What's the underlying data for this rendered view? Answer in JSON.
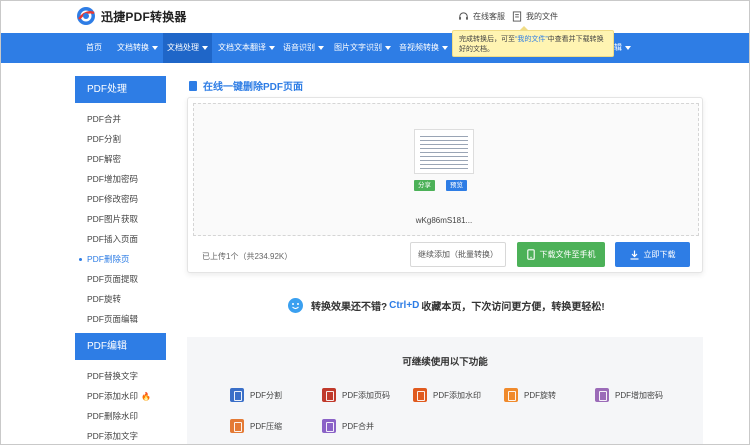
{
  "header": {
    "app_name": "迅捷PDF转换器",
    "support_label": "在线客服",
    "my_files_label": "我的文件"
  },
  "nav": {
    "items": [
      {
        "label": "首页",
        "has_caret": false
      },
      {
        "label": "文档转换",
        "has_caret": true
      },
      {
        "label": "文档处理",
        "has_caret": true,
        "active": true
      },
      {
        "label": "文档文本翻译",
        "has_caret": true
      },
      {
        "label": "语音识别",
        "has_caret": true
      },
      {
        "label": "图片文字识别",
        "has_caret": true
      },
      {
        "label": "音视频转换",
        "has_caret": true
      },
      {
        "label": "辑",
        "has_caret": true
      }
    ]
  },
  "tooltip": {
    "prefix": "完成转换后，可至",
    "link": "“我的文件”",
    "suffix": "中查看并下载转换好的文档。"
  },
  "sidebar": {
    "sections": [
      {
        "title": "PDF处理",
        "items": [
          "PDF合并",
          "PDF分割",
          "PDF解密",
          "PDF增加密码",
          "PDF修改密码",
          "PDF图片获取",
          "PDF插入页面",
          "PDF删除页",
          "PDF页面提取",
          "PDF旋转",
          "PDF页面编辑"
        ],
        "active_index": 7
      },
      {
        "title": "PDF编辑",
        "items": [
          "PDF替换文字",
          "PDF添加水印",
          "PDF删除水印",
          "PDF添加文字"
        ],
        "hot_index": 1
      }
    ]
  },
  "main": {
    "title": "在线一键删除PDF页面",
    "file": {
      "share_label": "分享",
      "preview_label": "预览",
      "name": "wKg86mS181..."
    },
    "upload_info": "已上传1个（共234.92K）",
    "continue_label": "继续添加（批量转换）",
    "download_phone_label": "下载文件至手机",
    "download_now_label": "立即下载"
  },
  "tip": {
    "prefix": "转换效果还不错?",
    "key": "Ctrl+D",
    "suffix": "收藏本页，下次访问更方便，转换更轻松!"
  },
  "more": {
    "title": "可继续使用以下功能",
    "features": [
      {
        "label": "PDF分割",
        "color": "#3a6fc8"
      },
      {
        "label": "PDF添加页码",
        "color": "#c0392b"
      },
      {
        "label": "PDF添加水印",
        "color": "#e05a1e"
      },
      {
        "label": "PDF旋转",
        "color": "#f08a2c"
      },
      {
        "label": "PDF增加密码",
        "color": "#9b6bb8"
      },
      {
        "label": "PDF压缩",
        "color": "#e47a35"
      },
      {
        "label": "PDF合并",
        "color": "#8a62c7"
      }
    ]
  },
  "colors": {
    "accent": "#2e7de5",
    "nav_active": "#1f66c8",
    "green": "#4cb158",
    "tooltip_bg": "#fff4b2"
  }
}
